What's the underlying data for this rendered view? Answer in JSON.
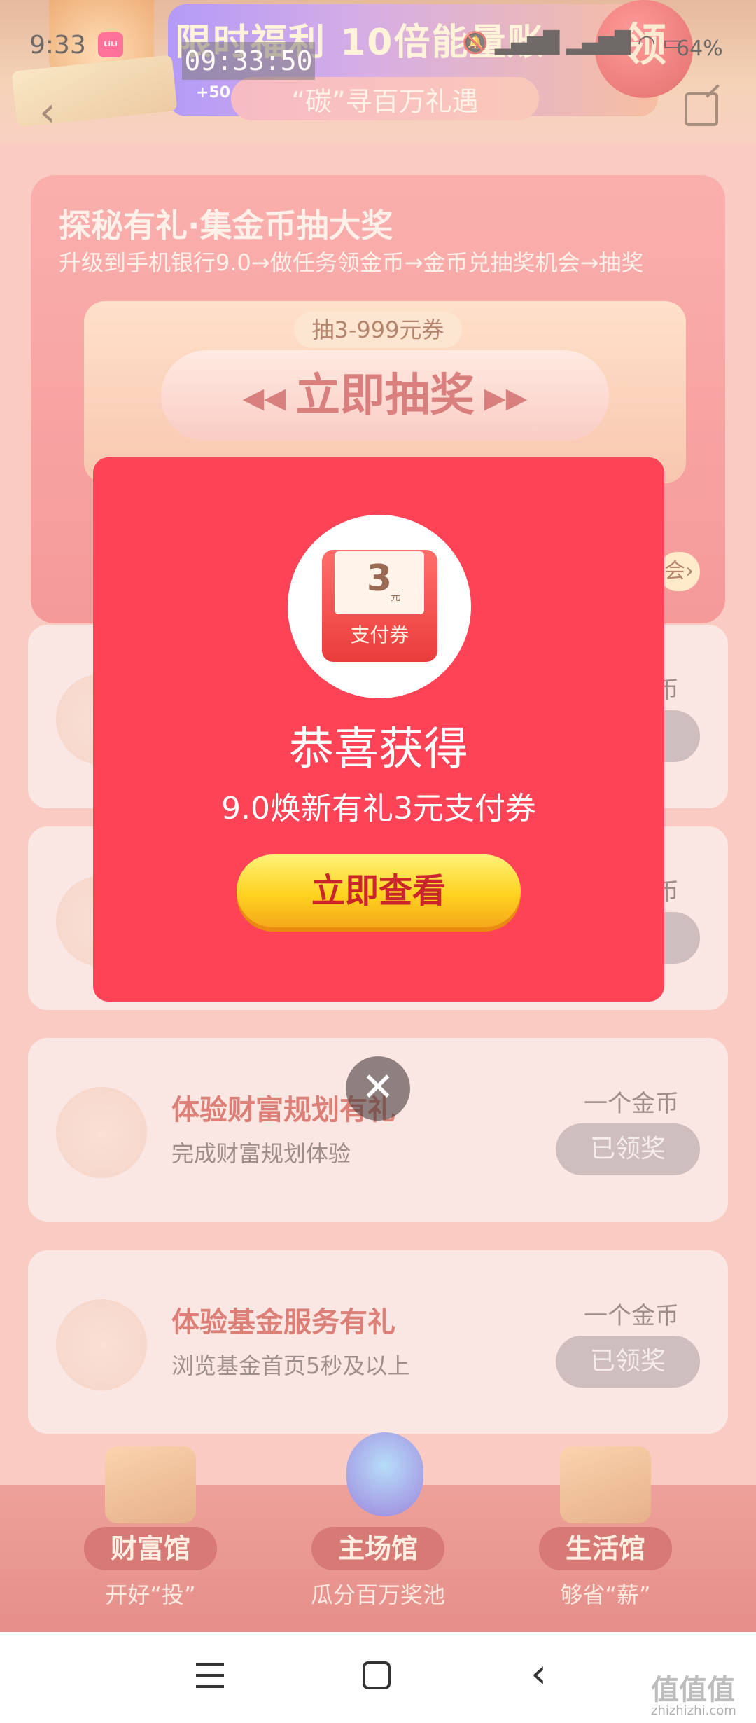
{
  "status_bar": {
    "time": "9:33",
    "clock_overlay": "09:33:50",
    "battery": "64%",
    "icons": [
      "mute-icon",
      "hd-signal-icon",
      "hd-signal-icon",
      "wifi-icon",
      "battery-icon"
    ]
  },
  "banner": {
    "title": "限时福利 10倍能量账",
    "subtitle": "“碳”寻百万礼遇",
    "claim": "领",
    "coin_chip": "+50"
  },
  "lottery": {
    "title": "探秘有礼·集金币抽大奖",
    "subtitle": "升级到手机银行9.0→做任务领金币→金币兑抽奖机会→抽奖",
    "tag": "抽3-999元券",
    "button": "立即抽奖",
    "footer_link": "会"
  },
  "tasks": [
    {
      "title": "",
      "desc": "",
      "reward": "币",
      "button": ""
    },
    {
      "title": "",
      "desc": "",
      "reward": "币",
      "button": ""
    },
    {
      "title": "体验财富规划有礼",
      "desc": "完成财富规划体验",
      "reward": "一个金币",
      "button": "已领奖"
    },
    {
      "title": "体验基金服务有礼",
      "desc": "浏览基金首页5秒及以上",
      "reward": "一个金币",
      "button": "已领奖"
    }
  ],
  "bottom_nav": [
    {
      "label": "财富馆",
      "sub": "开好“投”"
    },
    {
      "label": "主场馆",
      "sub": "瓜分百万奖池"
    },
    {
      "label": "生活馆",
      "sub": "够省“薪”"
    }
  ],
  "modal": {
    "voucher_amount": "3",
    "voucher_unit": "元",
    "voucher_label": "支付券",
    "title": "恭喜获得",
    "desc": "9.0焕新有礼3元支付券",
    "button": "立即查看",
    "close": "✕"
  },
  "watermark": {
    "logo": "值值值",
    "site": "zhizhizhi.com"
  },
  "colors": {
    "modal_bg": "#fe4356",
    "button_yellow": "#ffd21f",
    "task_title": "#c8433a",
    "page_bg": "#f6b7ad"
  }
}
